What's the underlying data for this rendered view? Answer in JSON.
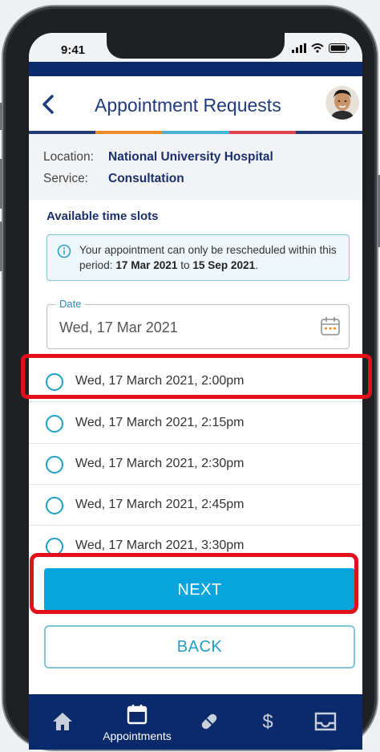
{
  "status_bar": {
    "time": "9:41"
  },
  "header": {
    "title": "Appointment Requests"
  },
  "info": {
    "location_label": "Location:",
    "location_value": "National University Hospital",
    "service_label": "Service:",
    "service_value": "Consultation"
  },
  "slots_section": {
    "title": "Available time slots"
  },
  "notice": {
    "text_before": "Your appointment can only be rescheduled within this period: ",
    "start_date": "17 Mar 2021",
    "middle": " to ",
    "end_date": "15 Sep 2021",
    "text_after": "."
  },
  "date_field": {
    "label": "Date",
    "value": "Wed, 17 Mar 2021"
  },
  "time_slots": [
    {
      "label": "Wed, 17 March 2021, 2:00pm",
      "selected": false
    },
    {
      "label": "Wed, 17 March 2021, 2:15pm",
      "selected": false
    },
    {
      "label": "Wed, 17 March 2021, 2:30pm",
      "selected": false
    },
    {
      "label": "Wed, 17 March 2021, 2:45pm",
      "selected": false
    },
    {
      "label": "Wed, 17 March 2021, 3:30pm",
      "selected": false
    }
  ],
  "actions": {
    "next_label": "NEXT",
    "back_label": "BACK"
  },
  "bottom_nav": {
    "items": [
      {
        "icon": "home-icon",
        "label": ""
      },
      {
        "icon": "calendar-icon",
        "label": "Appointments"
      },
      {
        "icon": "pill-icon",
        "label": ""
      },
      {
        "icon": "dollar-icon",
        "label": ""
      },
      {
        "icon": "inbox-icon",
        "label": ""
      }
    ]
  },
  "colors": {
    "navy": "#0b2a6b",
    "accent_blue": "#07a5dd",
    "title_blue": "#1f3b7a",
    "highlight_red": "#e2101a",
    "stripe": [
      "#1f3b7a",
      "#f28c28",
      "#4cb3d8",
      "#e0414b",
      "#1f3b7a"
    ]
  }
}
